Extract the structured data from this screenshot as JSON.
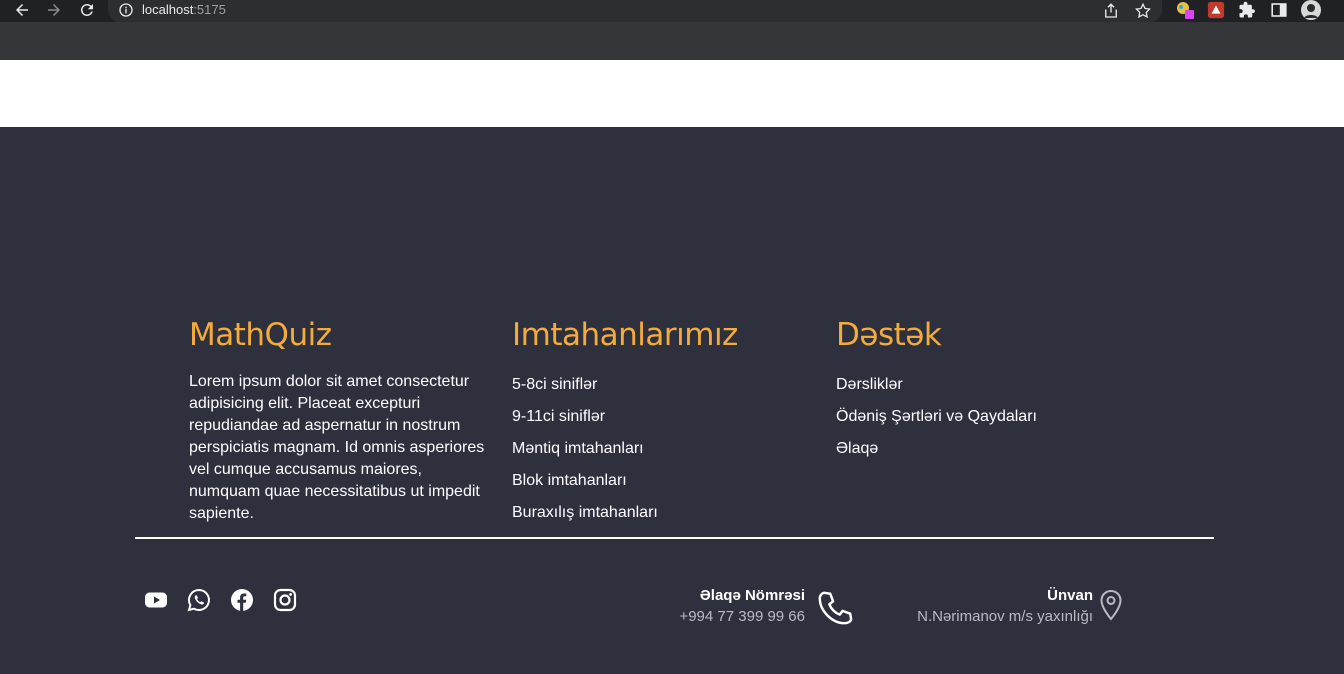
{
  "browser": {
    "url_host": "localhost",
    "url_port": ":5175"
  },
  "footer": {
    "about": {
      "title": "MathQuiz",
      "text": "Lorem ipsum dolor sit amet consectetur adipisicing elit. Placeat excepturi repudiandae ad aspernatur in nostrum perspiciatis magnam. Id omnis asperiores vel cumque accusamus maiores, numquam quae necessitatibus ut impedit sapiente."
    },
    "exams": {
      "title": "Imtahanlarımız",
      "links": [
        "5-8ci siniflər",
        "9-11ci siniflər",
        "Məntiq imtahanları",
        "Blok imtahanları",
        "Buraxılış imtahanları"
      ]
    },
    "support": {
      "title": "Dəstək",
      "links": [
        "Dərsliklər",
        "Ödəniş Şərtləri və Qaydaları",
        "Əlaqə"
      ]
    },
    "socials": [
      "youtube-icon",
      "whatsapp-icon",
      "facebook-icon",
      "instagram-icon"
    ],
    "phone": {
      "label": "Əlaqə Nömrəsi",
      "value": "+994 77 399 99 66",
      "icon": "phone-icon"
    },
    "address": {
      "label": "Ünvan",
      "value": "N.Nərimanov m/s yaxınlığı",
      "icon": "location-pin-icon"
    }
  },
  "colors": {
    "footer_bg": "#2f303d",
    "accent": "#f3ac3b",
    "text": "#ffffff",
    "muted": "#b9bac4"
  }
}
